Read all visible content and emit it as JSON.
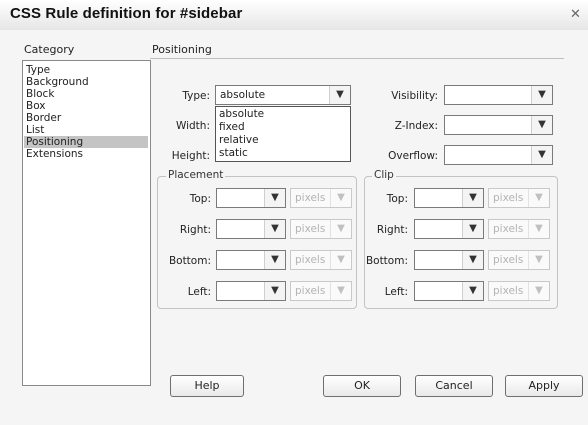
{
  "window": {
    "title": "CSS Rule definition for #sidebar",
    "close_symbol": "✕"
  },
  "category": {
    "header": "Category",
    "items": [
      "Type",
      "Background",
      "Block",
      "Box",
      "Border",
      "List",
      "Positioning",
      "Extensions"
    ],
    "selected": "Positioning"
  },
  "panel": {
    "header": "Positioning"
  },
  "fields": {
    "type": {
      "label": "Type:",
      "value": "absolute"
    },
    "type_options": [
      "absolute",
      "fixed",
      "relative",
      "static"
    ],
    "width": {
      "label": "Width:"
    },
    "height": {
      "label": "Height:"
    },
    "visibility": {
      "label": "Visibility:",
      "value": ""
    },
    "zindex": {
      "label": "Z-Index:",
      "value": ""
    },
    "overflow": {
      "label": "Overflow:",
      "value": ""
    }
  },
  "placement": {
    "legend": "Placement",
    "top": {
      "label": "Top:",
      "unit": "pixels"
    },
    "right": {
      "label": "Right:",
      "unit": "pixels"
    },
    "bottom": {
      "label": "Bottom:",
      "unit": "pixels"
    },
    "left": {
      "label": "Left:",
      "unit": "pixels"
    }
  },
  "clip": {
    "legend": "Clip",
    "top": {
      "label": "Top:",
      "unit": "pixels"
    },
    "right": {
      "label": "Right:",
      "unit": "pixels"
    },
    "bottom": {
      "label": "Bottom:",
      "unit": "pixels"
    },
    "left": {
      "label": "Left:",
      "unit": "pixels"
    }
  },
  "buttons": {
    "help": "Help",
    "ok": "OK",
    "cancel": "Cancel",
    "apply": "Apply"
  },
  "icons": {
    "dropdown_arrow": "chevron-down-icon",
    "close": "close-icon"
  },
  "colors": {
    "selection": "#c4c4c4",
    "dialog_bg": "#f5f5f5",
    "border": "#7a7a7a"
  }
}
